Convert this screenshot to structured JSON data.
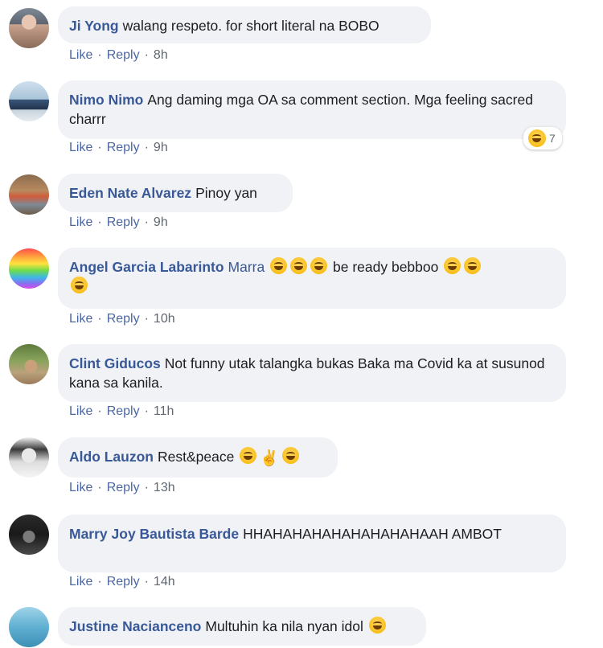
{
  "actions": {
    "like": "Like",
    "reply": "Reply",
    "dot": "·"
  },
  "comments": [
    {
      "author": "Ji Yong",
      "text": "walang respeto. for short literal na BOBO",
      "time": "8h"
    },
    {
      "author": "Nimo Nimo",
      "text": "Ang daming mga OA sa comment section. Mga feeling sacred charrr",
      "time": "9h",
      "reaction_count": "7"
    },
    {
      "author": "Eden Nate Alvarez",
      "text": "Pinoy yan",
      "time": "9h"
    },
    {
      "author": "Angel Garcia Labarinto",
      "mention": "Marra",
      "text": "be ready bebboo",
      "time": "10h"
    },
    {
      "author": "Clint Giducos",
      "text": "Not funny utak talangka bukas Baka ma Covid ka at susunod kana sa kanila.",
      "time": "11h"
    },
    {
      "author": "Aldo Lauzon",
      "text": "Rest&peace",
      "time": "13h"
    },
    {
      "author": "Marry Joy Bautista Barde",
      "text": "HHAHAHAHAHAHAHAHAHAAH AMBOT",
      "time": "14h"
    },
    {
      "author": "Justine Nacianceno",
      "text": "Multuhin ka nila nyan idol",
      "time": ""
    }
  ],
  "colors": {
    "link": "#385898",
    "bubble": "#f0f2f5",
    "meta": "#606770"
  }
}
